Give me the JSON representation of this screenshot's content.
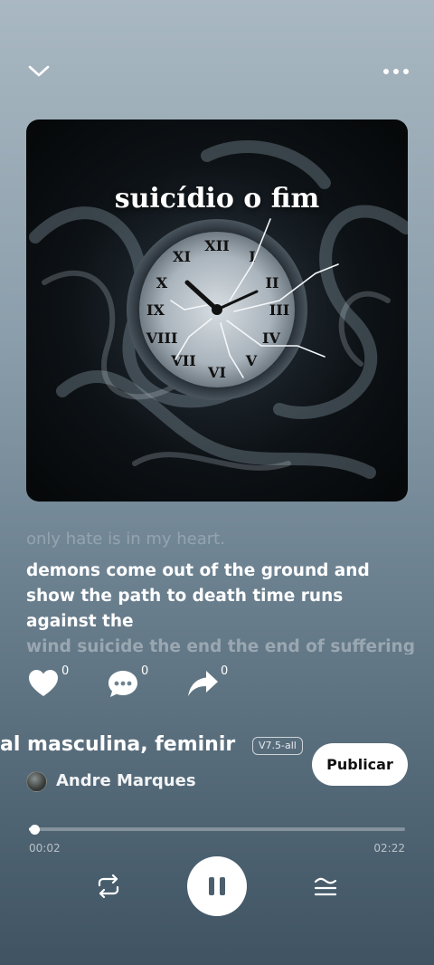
{
  "song": {
    "cover_title": "suicídio o fim"
  },
  "lyrics": {
    "previous": "only hate is in my heart.",
    "current": "demons come out of the ground and show the path to death time runs against the",
    "next": "wind suicide the end the end of suffering."
  },
  "actions": {
    "likes": "0",
    "comments": "0",
    "shares": "0"
  },
  "info": {
    "style": "al masculina, feminir",
    "version": "V7.5-all",
    "publish_label": "Publicar",
    "artist": "Andre Marques"
  },
  "player": {
    "elapsed": "00:02",
    "total": "02:22",
    "progress_fraction": 0.014
  },
  "icons": {
    "top_left": "chevron-down-icon",
    "top_right": "more-icon",
    "like": "heart-icon",
    "comment": "comment-icon",
    "share": "share-icon",
    "repeat": "repeat-icon",
    "pause": "pause-icon",
    "queue": "queue-icon"
  }
}
